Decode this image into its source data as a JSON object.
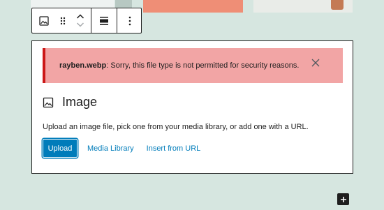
{
  "toolbar": {
    "buttons": [
      {
        "name": "block-type-image",
        "icon": "image-icon"
      },
      {
        "name": "drag-handle",
        "icon": "drag-handle-icon"
      },
      {
        "name": "move-up",
        "icon": "chevron-up-icon"
      },
      {
        "name": "move-down",
        "icon": "chevron-down-icon"
      },
      {
        "name": "align",
        "icon": "align-none-icon"
      },
      {
        "name": "more-options",
        "icon": "more-vertical-icon"
      }
    ]
  },
  "notice": {
    "filename": "rayben.webp",
    "message": ": Sorry, this file type is not permitted for security reasons.",
    "close_icon": "close-icon",
    "bg_color": "#f2a5a5",
    "accent_color": "#cc1818"
  },
  "placeholder": {
    "title": "Image",
    "title_icon": "image-icon",
    "instructions": "Upload an image file, pick one from your media library, or add one with a URL.",
    "upload_label": "Upload",
    "media_library_label": "Media Library",
    "insert_url_label": "Insert from URL"
  },
  "inserter": {
    "icon": "plus-icon"
  },
  "colors": {
    "primary": "#007cba",
    "background": "#d6e6e0",
    "text": "#1e1e1e"
  }
}
